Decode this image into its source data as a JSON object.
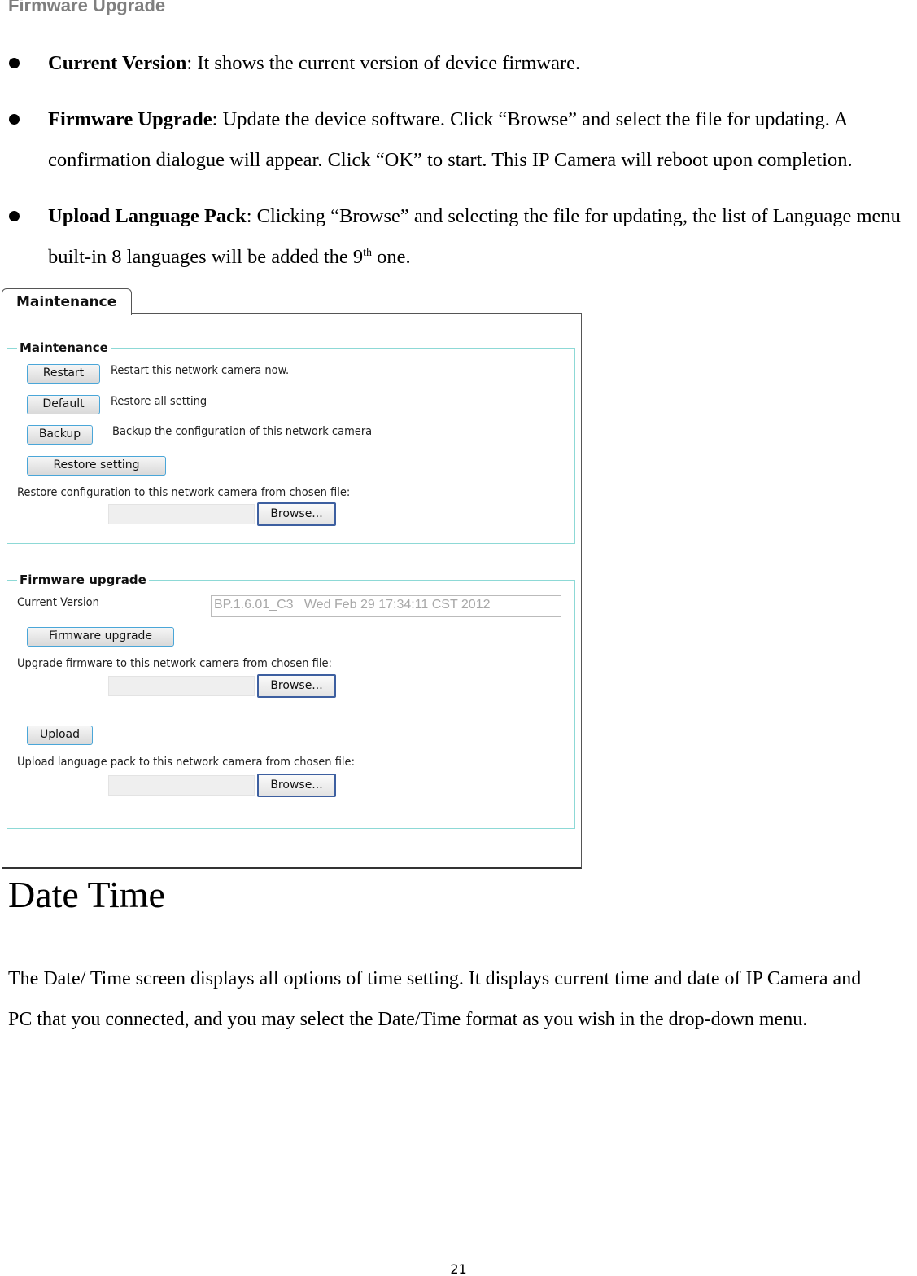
{
  "doc_title": "Firmware Upgrade",
  "bullets": [
    {
      "term": "Current Version",
      "text": ": It shows the current version of device firmware."
    },
    {
      "term": "Firmware Upgrade",
      "text": ": Update the device software. Click “Browse” and select the file for updating. A",
      "cont": "confirmation dialogue will appear. Click “OK” to start. This IP Camera will reboot upon completion."
    },
    {
      "term": "Upload Language Pack",
      "text": ": Clicking “Browse” and selecting the file for updating, the list of Language menu",
      "cont_a": "built-in 8 languages will be added the 9",
      "cont_sup": "th",
      "cont_b": " one."
    }
  ],
  "ui": {
    "tab": "Maintenance",
    "maintenance": {
      "legend": "Maintenance",
      "restart_btn": "Restart",
      "restart_desc": "Restart this network camera now.",
      "default_btn": "Default",
      "default_desc": "Restore all setting",
      "backup_btn": "Backup",
      "backup_desc": "Backup the configuration of this network camera",
      "restore_btn": "Restore setting",
      "restore_label": "Restore configuration to this network camera from chosen file:",
      "browse": "Browse..."
    },
    "firmware": {
      "legend": "Firmware upgrade",
      "current_label": "Current Version",
      "current_value": "BP.1.6.01_C3   Wed Feb 29 17:34:11 CST 2012",
      "upgrade_btn": "Firmware upgrade",
      "upgrade_label": "Upgrade firmware to this network camera from chosen file:",
      "upload_btn": "Upload",
      "upload_label": "Upload language pack to this network camera from chosen file:",
      "browse": "Browse..."
    }
  },
  "section_heading": "Date Time",
  "paragraph": [
    "The Date/ Time screen displays all options of time setting. It displays current time and date of IP Camera and",
    "PC that you connected, and you may select the Date/Time format as you wish in the drop-down menu."
  ],
  "page_number": "21"
}
